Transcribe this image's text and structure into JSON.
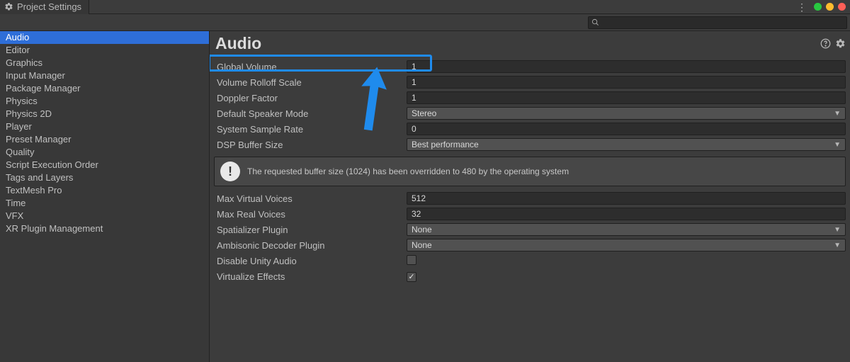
{
  "window": {
    "title": "Project Settings"
  },
  "search": {
    "placeholder": ""
  },
  "sidebar": {
    "items": [
      {
        "label": "Audio",
        "selected": true
      },
      {
        "label": "Editor"
      },
      {
        "label": "Graphics"
      },
      {
        "label": "Input Manager"
      },
      {
        "label": "Package Manager"
      },
      {
        "label": "Physics"
      },
      {
        "label": "Physics 2D"
      },
      {
        "label": "Player"
      },
      {
        "label": "Preset Manager"
      },
      {
        "label": "Quality"
      },
      {
        "label": "Script Execution Order"
      },
      {
        "label": "Tags and Layers"
      },
      {
        "label": "TextMesh Pro"
      },
      {
        "label": "Time"
      },
      {
        "label": "VFX"
      },
      {
        "label": "XR Plugin Management"
      }
    ]
  },
  "page": {
    "title": "Audio"
  },
  "fields": {
    "global_volume": {
      "label": "Global Volume",
      "value": "1"
    },
    "rolloff": {
      "label": "Volume Rolloff Scale",
      "value": "1"
    },
    "doppler": {
      "label": "Doppler Factor",
      "value": "1"
    },
    "speaker_mode": {
      "label": "Default Speaker Mode",
      "value": "Stereo"
    },
    "sample_rate": {
      "label": "System Sample Rate",
      "value": "0"
    },
    "dsp_buffer": {
      "label": "DSP Buffer Size",
      "value": "Best performance"
    },
    "info_msg": "The requested buffer size (1024) has been overridden to 480 by the operating system",
    "max_virtual": {
      "label": "Max Virtual Voices",
      "value": "512"
    },
    "max_real": {
      "label": "Max Real Voices",
      "value": "32"
    },
    "spatializer": {
      "label": "Spatializer Plugin",
      "value": "None"
    },
    "ambisonic": {
      "label": "Ambisonic Decoder Plugin",
      "value": "None"
    },
    "disable_audio": {
      "label": "Disable Unity Audio",
      "checked": false
    },
    "virtualize": {
      "label": "Virtualize Effects",
      "checked": true
    }
  },
  "colors": {
    "highlight": "#1f8bed",
    "selection": "#2e6ed8"
  }
}
